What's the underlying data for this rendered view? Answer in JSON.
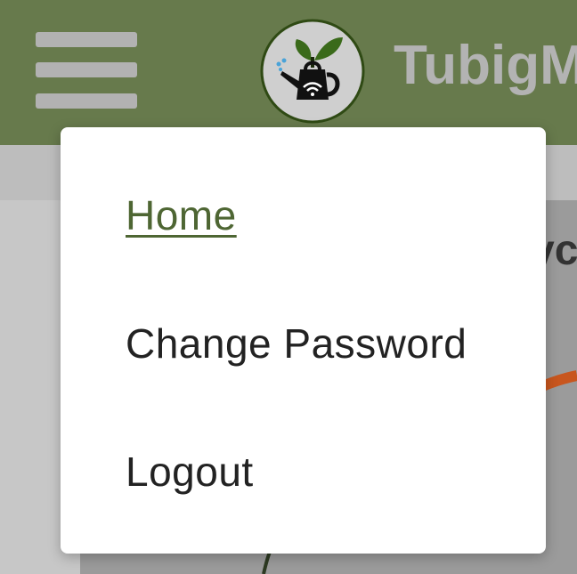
{
  "header": {
    "title": "TubigM",
    "menu_icon": "hamburger-menu-icon",
    "logo_icon": "watering-can-plant-wifi-logo"
  },
  "menu": {
    "items": [
      {
        "label": "Home",
        "active": true
      },
      {
        "label": "Change Password",
        "active": false
      },
      {
        "label": "Logout",
        "active": false
      }
    ]
  },
  "background": {
    "partial_heading": "vc"
  },
  "colors": {
    "header_bg": "#677a4c",
    "title_text": "#b3b3b3",
    "active_link": "#4e6633",
    "gauge_accent": "#c8561e"
  }
}
